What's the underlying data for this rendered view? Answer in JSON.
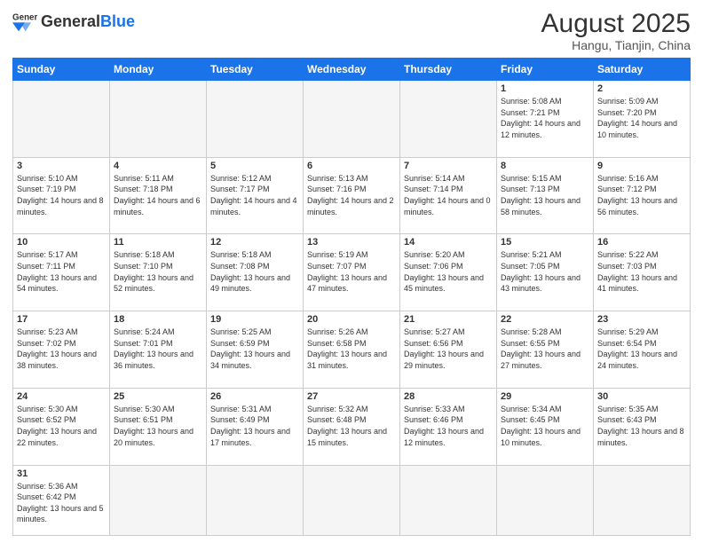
{
  "logo": {
    "general": "General",
    "blue": "Blue"
  },
  "header": {
    "title": "August 2025",
    "subtitle": "Hangu, Tianjin, China"
  },
  "weekdays": [
    "Sunday",
    "Monday",
    "Tuesday",
    "Wednesday",
    "Thursday",
    "Friday",
    "Saturday"
  ],
  "weeks": [
    [
      {
        "day": "",
        "info": ""
      },
      {
        "day": "",
        "info": ""
      },
      {
        "day": "",
        "info": ""
      },
      {
        "day": "",
        "info": ""
      },
      {
        "day": "",
        "info": ""
      },
      {
        "day": "1",
        "info": "Sunrise: 5:08 AM\nSunset: 7:21 PM\nDaylight: 14 hours\nand 12 minutes."
      },
      {
        "day": "2",
        "info": "Sunrise: 5:09 AM\nSunset: 7:20 PM\nDaylight: 14 hours\nand 10 minutes."
      }
    ],
    [
      {
        "day": "3",
        "info": "Sunrise: 5:10 AM\nSunset: 7:19 PM\nDaylight: 14 hours\nand 8 minutes."
      },
      {
        "day": "4",
        "info": "Sunrise: 5:11 AM\nSunset: 7:18 PM\nDaylight: 14 hours\nand 6 minutes."
      },
      {
        "day": "5",
        "info": "Sunrise: 5:12 AM\nSunset: 7:17 PM\nDaylight: 14 hours\nand 4 minutes."
      },
      {
        "day": "6",
        "info": "Sunrise: 5:13 AM\nSunset: 7:16 PM\nDaylight: 14 hours\nand 2 minutes."
      },
      {
        "day": "7",
        "info": "Sunrise: 5:14 AM\nSunset: 7:14 PM\nDaylight: 14 hours\nand 0 minutes."
      },
      {
        "day": "8",
        "info": "Sunrise: 5:15 AM\nSunset: 7:13 PM\nDaylight: 13 hours\nand 58 minutes."
      },
      {
        "day": "9",
        "info": "Sunrise: 5:16 AM\nSunset: 7:12 PM\nDaylight: 13 hours\nand 56 minutes."
      }
    ],
    [
      {
        "day": "10",
        "info": "Sunrise: 5:17 AM\nSunset: 7:11 PM\nDaylight: 13 hours\nand 54 minutes."
      },
      {
        "day": "11",
        "info": "Sunrise: 5:18 AM\nSunset: 7:10 PM\nDaylight: 13 hours\nand 52 minutes."
      },
      {
        "day": "12",
        "info": "Sunrise: 5:18 AM\nSunset: 7:08 PM\nDaylight: 13 hours\nand 49 minutes."
      },
      {
        "day": "13",
        "info": "Sunrise: 5:19 AM\nSunset: 7:07 PM\nDaylight: 13 hours\nand 47 minutes."
      },
      {
        "day": "14",
        "info": "Sunrise: 5:20 AM\nSunset: 7:06 PM\nDaylight: 13 hours\nand 45 minutes."
      },
      {
        "day": "15",
        "info": "Sunrise: 5:21 AM\nSunset: 7:05 PM\nDaylight: 13 hours\nand 43 minutes."
      },
      {
        "day": "16",
        "info": "Sunrise: 5:22 AM\nSunset: 7:03 PM\nDaylight: 13 hours\nand 41 minutes."
      }
    ],
    [
      {
        "day": "17",
        "info": "Sunrise: 5:23 AM\nSunset: 7:02 PM\nDaylight: 13 hours\nand 38 minutes."
      },
      {
        "day": "18",
        "info": "Sunrise: 5:24 AM\nSunset: 7:01 PM\nDaylight: 13 hours\nand 36 minutes."
      },
      {
        "day": "19",
        "info": "Sunrise: 5:25 AM\nSunset: 6:59 PM\nDaylight: 13 hours\nand 34 minutes."
      },
      {
        "day": "20",
        "info": "Sunrise: 5:26 AM\nSunset: 6:58 PM\nDaylight: 13 hours\nand 31 minutes."
      },
      {
        "day": "21",
        "info": "Sunrise: 5:27 AM\nSunset: 6:56 PM\nDaylight: 13 hours\nand 29 minutes."
      },
      {
        "day": "22",
        "info": "Sunrise: 5:28 AM\nSunset: 6:55 PM\nDaylight: 13 hours\nand 27 minutes."
      },
      {
        "day": "23",
        "info": "Sunrise: 5:29 AM\nSunset: 6:54 PM\nDaylight: 13 hours\nand 24 minutes."
      }
    ],
    [
      {
        "day": "24",
        "info": "Sunrise: 5:30 AM\nSunset: 6:52 PM\nDaylight: 13 hours\nand 22 minutes."
      },
      {
        "day": "25",
        "info": "Sunrise: 5:30 AM\nSunset: 6:51 PM\nDaylight: 13 hours\nand 20 minutes."
      },
      {
        "day": "26",
        "info": "Sunrise: 5:31 AM\nSunset: 6:49 PM\nDaylight: 13 hours\nand 17 minutes."
      },
      {
        "day": "27",
        "info": "Sunrise: 5:32 AM\nSunset: 6:48 PM\nDaylight: 13 hours\nand 15 minutes."
      },
      {
        "day": "28",
        "info": "Sunrise: 5:33 AM\nSunset: 6:46 PM\nDaylight: 13 hours\nand 12 minutes."
      },
      {
        "day": "29",
        "info": "Sunrise: 5:34 AM\nSunset: 6:45 PM\nDaylight: 13 hours\nand 10 minutes."
      },
      {
        "day": "30",
        "info": "Sunrise: 5:35 AM\nSunset: 6:43 PM\nDaylight: 13 hours\nand 8 minutes."
      }
    ],
    [
      {
        "day": "31",
        "info": "Sunrise: 5:36 AM\nSunset: 6:42 PM\nDaylight: 13 hours\nand 5 minutes."
      },
      {
        "day": "",
        "info": ""
      },
      {
        "day": "",
        "info": ""
      },
      {
        "day": "",
        "info": ""
      },
      {
        "day": "",
        "info": ""
      },
      {
        "day": "",
        "info": ""
      },
      {
        "day": "",
        "info": ""
      }
    ]
  ]
}
